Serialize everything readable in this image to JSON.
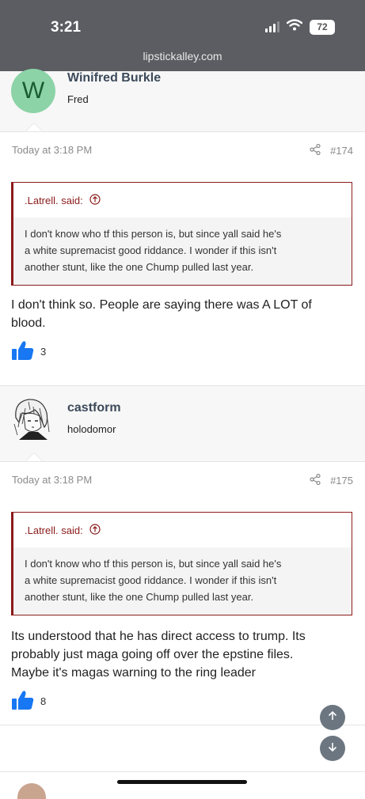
{
  "status_bar": {
    "time": "3:21",
    "battery": "72"
  },
  "browser": {
    "url": "lipstickalley.com"
  },
  "posts": [
    {
      "author": {
        "avatar_letter": "W",
        "name": "Winifred Burkle",
        "title": "Fred"
      },
      "date": "Today at 3:18 PM",
      "number": "#174",
      "quote": {
        "source": ".Latrell. said:",
        "lines": [
          "I don't know who tf this person is, but since yall said he's",
          "a white supremacist good riddance. I wonder if this isn't",
          "another stunt, like the one Chump pulled last year."
        ]
      },
      "body_lines": [
        "I don't think so. People are saying there was A LOT of",
        "blood."
      ],
      "like_count": "3"
    },
    {
      "author": {
        "name": "castform",
        "title": "holodomor"
      },
      "date": "Today at 3:18 PM",
      "number": "#175",
      "quote": {
        "source": ".Latrell. said:",
        "lines": [
          "I don't know who tf this person is, but since yall said he's",
          "a white supremacist good riddance. I wonder if this isn't",
          "another stunt, like the one Chump pulled last year."
        ]
      },
      "body_lines": [
        "Its understood that he has direct access to trump. Its",
        "probably just maga going off over the epstine files.",
        "Maybe it's magas warning to the ring leader"
      ],
      "like_count": "8"
    }
  ],
  "icons": {
    "share": "share-icon",
    "quote_arrow": "arrow-up-circle-icon",
    "like": "thumbs-up-icon",
    "scroll_up": "arrow-up-icon",
    "scroll_down": "arrow-down-icon"
  },
  "colors": {
    "quote_border": "#8b1a1a",
    "username": "#3c4a5a",
    "like_blue": "#1877f2",
    "avatar_bg": "#8cd3a7",
    "avatar_letter": "#1b5c33",
    "status_bar": "#5b5d62"
  }
}
